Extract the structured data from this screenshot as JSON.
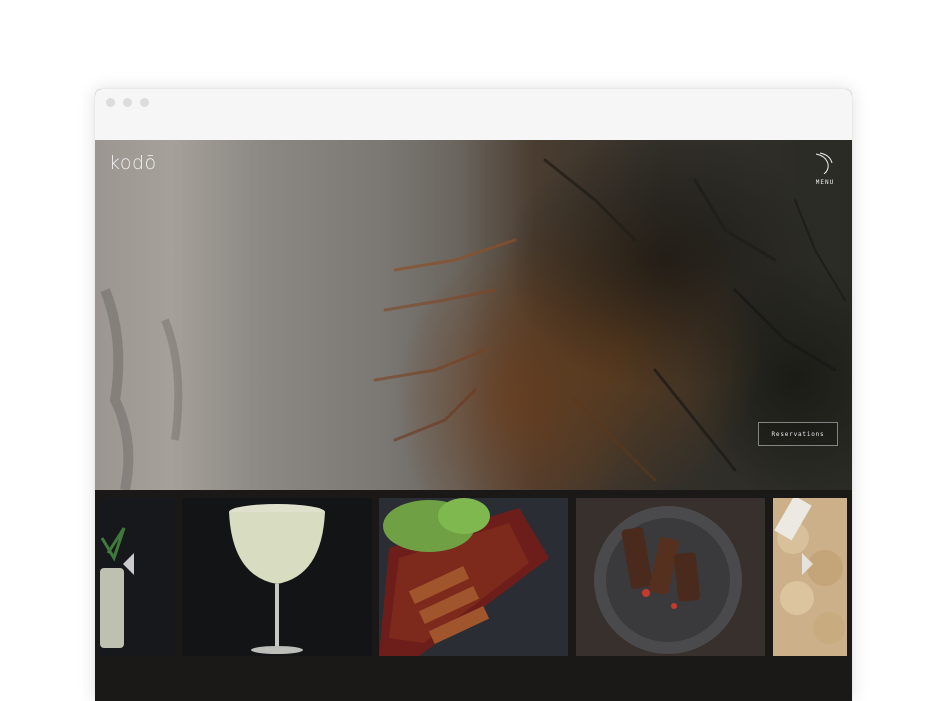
{
  "app": {
    "logo": "kodō"
  },
  "header": {
    "menu_label": "MENU"
  },
  "hero": {
    "reservation_label": "Reservations"
  },
  "gallery": {
    "items": [
      {
        "subject": "cocktail-glass-with-garnish"
      },
      {
        "subject": "coupe-cocktail"
      },
      {
        "subject": "glazed-pork-belly-platter"
      },
      {
        "subject": "grilled-meat-plate"
      },
      {
        "subject": "fried-appetizer"
      }
    ]
  }
}
